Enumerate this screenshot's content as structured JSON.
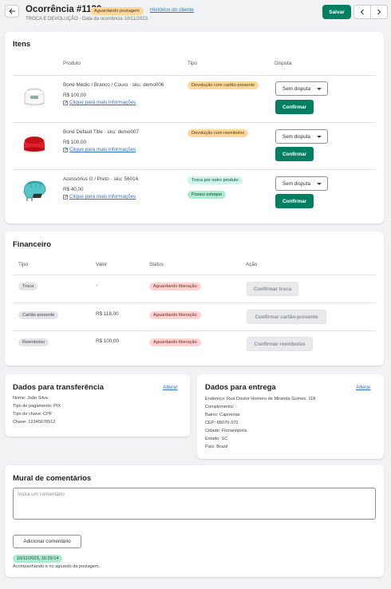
{
  "header": {
    "title": "Ocorrência #1130",
    "status_badge": "Aguardando postagem",
    "history_link": "Histórico do cliente",
    "subtitle_type": "TROCA E DEVOLUÇÃO",
    "subtitle_date": "Data da ocorrência 10/11/2023",
    "save_label": "Salvar"
  },
  "items": {
    "title": "Itens",
    "columns": {
      "product": "Produto",
      "type": "Tipo",
      "dispute": "Disputa"
    },
    "rows": [
      {
        "name": "Boné Médio / Branco / Couro · sku: demo006",
        "price": "R$ 100,00",
        "link": "Clique para mais informações",
        "types": [
          "Devolução com cartão-presente"
        ],
        "dispute": "Sem disputa",
        "confirm": "Confirmar",
        "icon": "white-cap-icon"
      },
      {
        "name": "Boné Default Title · sku: demo007",
        "price": "R$ 100,00",
        "link": "Clique para mais informações",
        "types": [
          "Devolução com reembolso"
        ],
        "dispute": "Sem disputa",
        "confirm": "Confirmar",
        "icon": "red-cap-icon"
      },
      {
        "name": "Acessórios G / Preto · sku: 56014",
        "price": "R$ 40,00",
        "link": "Clique para mais informações",
        "types": [
          "Troca por outro produto",
          "Possui estoque"
        ],
        "dispute": "Sem disputa",
        "confirm": "Confirmar",
        "icon": "helmet-icon"
      }
    ]
  },
  "financeiro": {
    "title": "Financeiro",
    "columns": {
      "type": "Tipo",
      "value": "Valor",
      "status": "Status",
      "action": "Ação"
    },
    "rows": [
      {
        "type": "Troca",
        "value": "-",
        "status": "Aguardando liberação",
        "action": "Confirmar troca"
      },
      {
        "type": "Cartão-presente",
        "value": "R$ 118,00",
        "status": "Aguardando liberação",
        "action": "Confirmar cartão-presente"
      },
      {
        "type": "Reembolso",
        "value": "R$ 100,00",
        "status": "Aguardando liberação",
        "action": "Confirmar reembolso"
      }
    ]
  },
  "transfer": {
    "title": "Dados para transferência",
    "edit": "Alterar",
    "lines": [
      "Nome: João Silva",
      "Tipo de pagamento: PIX",
      "Tipo de chave: CPF",
      "Chave: 12345678912"
    ]
  },
  "delivery": {
    "title": "Dados para entrega",
    "edit": "Alterar",
    "lines": [
      "Endereço: Rua Doutor Homero de Miranda Gomes, 118",
      "Complemento: -",
      "Bairro: Capoeiras",
      "CEP: 88070-370",
      "Cidade: Florianópolis",
      "Estado: SC",
      "País: Brazil"
    ]
  },
  "comments": {
    "title": "Mural de comentários",
    "placeholder": "Insira um comentário",
    "add_label": "Adicionar comentário",
    "entry_time": "10/11/2023, 15:29:14",
    "entry_text": "Acompanhando e no aguardo da postagem."
  },
  "colors": {
    "primary": "#008060",
    "link": "#2c6ecb",
    "badge_yellow": "#ffd79d",
    "badge_teal": "#aee9d1",
    "badge_red": "#fed3d1"
  }
}
